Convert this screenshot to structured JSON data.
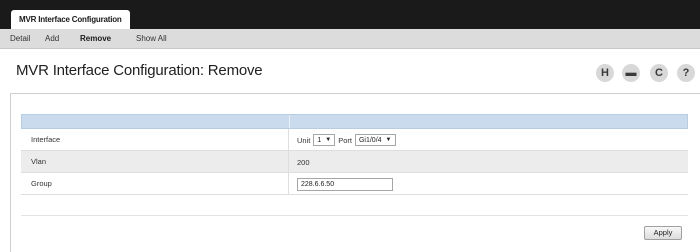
{
  "header": {
    "main_tab": "MVR Interface Configuration"
  },
  "subnav": {
    "items": [
      "Detail",
      "Add",
      "Remove",
      "Show All"
    ],
    "active": "Remove"
  },
  "page": {
    "title": "MVR Interface Configuration: Remove"
  },
  "toolbar": {
    "icons": [
      {
        "name": "save-icon",
        "glyph": "H"
      },
      {
        "name": "print-icon",
        "glyph": "▬"
      },
      {
        "name": "refresh-icon",
        "glyph": "C"
      },
      {
        "name": "help-icon",
        "glyph": "?"
      }
    ]
  },
  "form": {
    "interface": {
      "label": "Interface",
      "unit_label": "Unit",
      "unit_value": "1",
      "port_label": "Port",
      "port_value": "Gi1/0/4"
    },
    "vlan": {
      "label": "Vlan",
      "value": "200"
    },
    "group": {
      "label": "Group",
      "value": "228.6.6.50"
    }
  },
  "actions": {
    "apply_label": "Apply"
  }
}
